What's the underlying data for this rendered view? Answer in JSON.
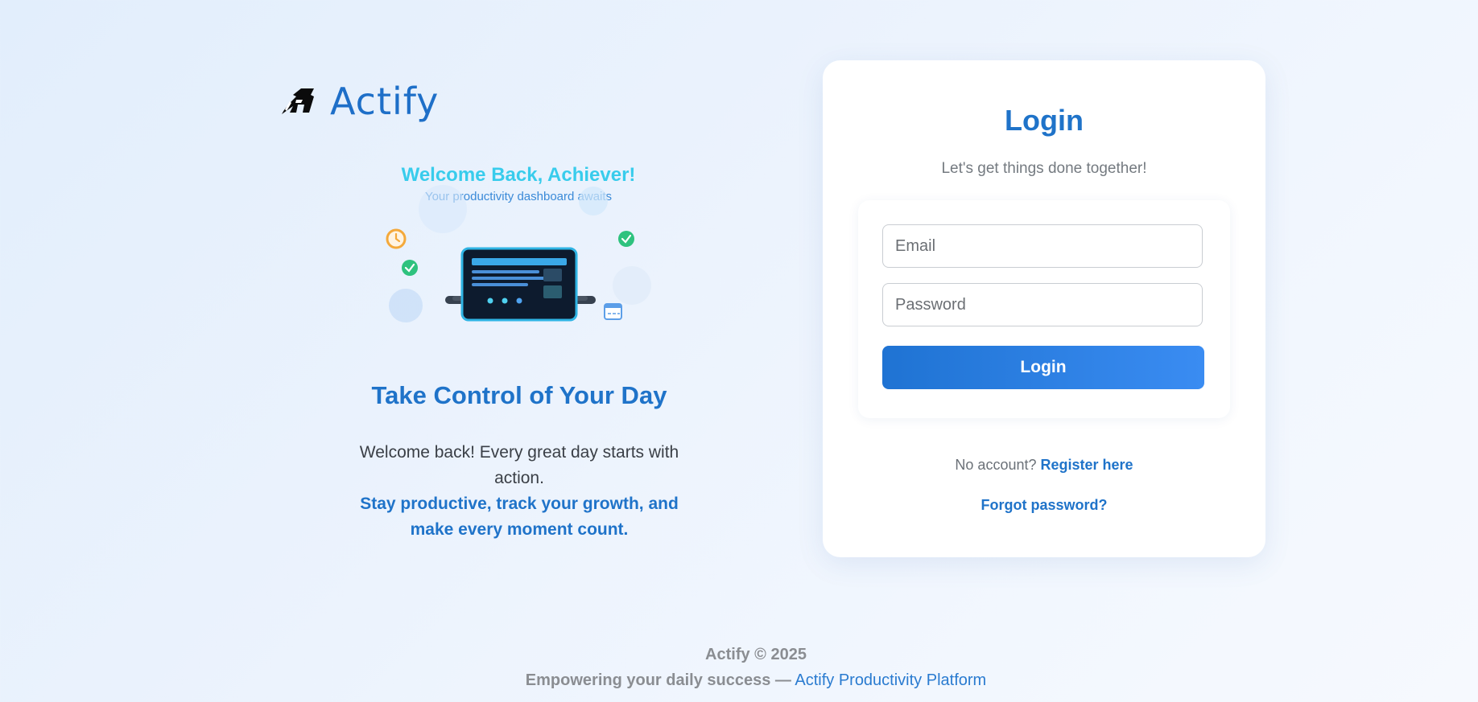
{
  "brand": {
    "name": "Actify",
    "logo_icon": "stylized-logo-icon"
  },
  "hero": {
    "title": "Welcome Back, Achiever!",
    "subtitle": "Your productivity dashboard awaits",
    "illustration_icons": [
      "clock-icon",
      "check-icon",
      "check-icon",
      "calendar-icon",
      "laptop-icon"
    ]
  },
  "intro": {
    "heading": "Take Control of Your Day",
    "text": "Welcome back! Every great day starts with action.",
    "highlight": "Stay productive, track your growth, and make every moment count."
  },
  "login": {
    "title": "Login",
    "subtitle": "Let's get things done together!",
    "email_placeholder": "Email",
    "password_placeholder": "Password",
    "button_label": "Login",
    "no_account_text": "No account?",
    "register_link": "Register here",
    "forgot_link": "Forgot password?"
  },
  "footer": {
    "copyright": "Actify © 2025",
    "tagline": "Empowering your daily success —",
    "platform_link": "Actify Productivity Platform"
  },
  "colors": {
    "accent": "#1f73c9",
    "hero_title": "#38ccec",
    "success": "#2ec27e",
    "warning": "#f4a93b"
  }
}
